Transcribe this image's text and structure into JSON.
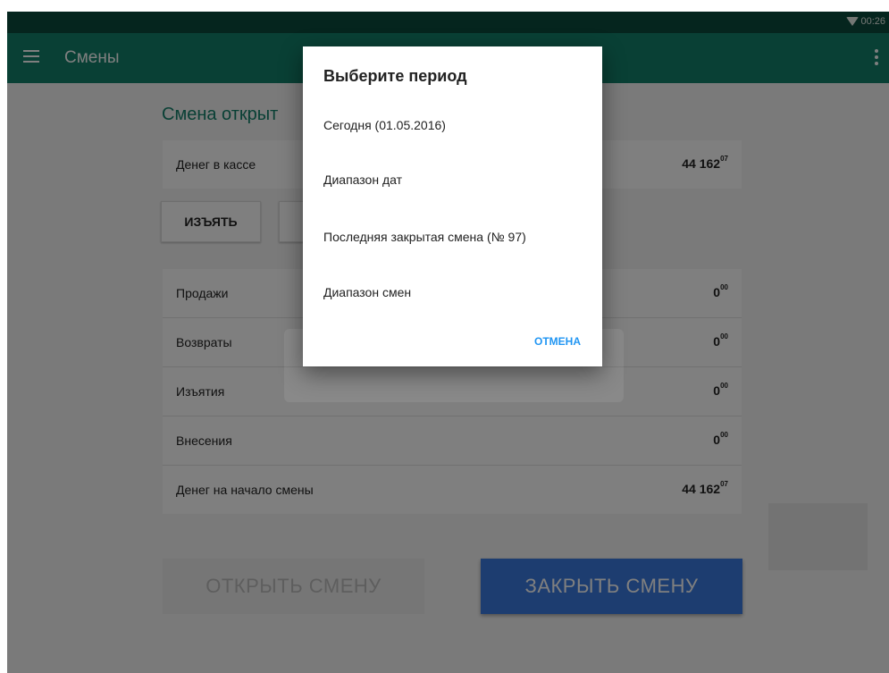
{
  "status_bar": {
    "time": "00:26"
  },
  "app_bar": {
    "title": "Смены"
  },
  "shift": {
    "heading": "Смена открыт",
    "cash": {
      "label": "Денег в кассе",
      "value": "44 162",
      "cents": "07"
    },
    "withdraw_label": "ИЗЪЯТЬ",
    "deposit_label": ""
  },
  "summary": {
    "rows": [
      {
        "label": "Продажи",
        "value": "0",
        "cents": "00"
      },
      {
        "label": "Возвраты",
        "value": "0",
        "cents": "00"
      },
      {
        "label": "Изъятия",
        "value": "0",
        "cents": "00"
      },
      {
        "label": "Внесения",
        "value": "0",
        "cents": "00"
      },
      {
        "label": "Денег на начало смены",
        "value": "44 162",
        "cents": "07"
      }
    ]
  },
  "actions": {
    "open_label": "ОТКРЫТЬ СМЕНУ",
    "close_label": "ЗАКРЫТЬ СМЕНУ"
  },
  "dialog": {
    "title": "Выберите период",
    "options": [
      "Сегодня (01.05.2016)",
      "Диапазон дат",
      "Последняя закрытая смена (№ 97)",
      "Диапазон смен"
    ],
    "cancel_label": "ОТМЕНА"
  },
  "colors": {
    "app_bar": "#13806b",
    "status_bar": "#0b4a3d",
    "accent": "#3b7ae0",
    "dialog_action": "#2196f3"
  }
}
